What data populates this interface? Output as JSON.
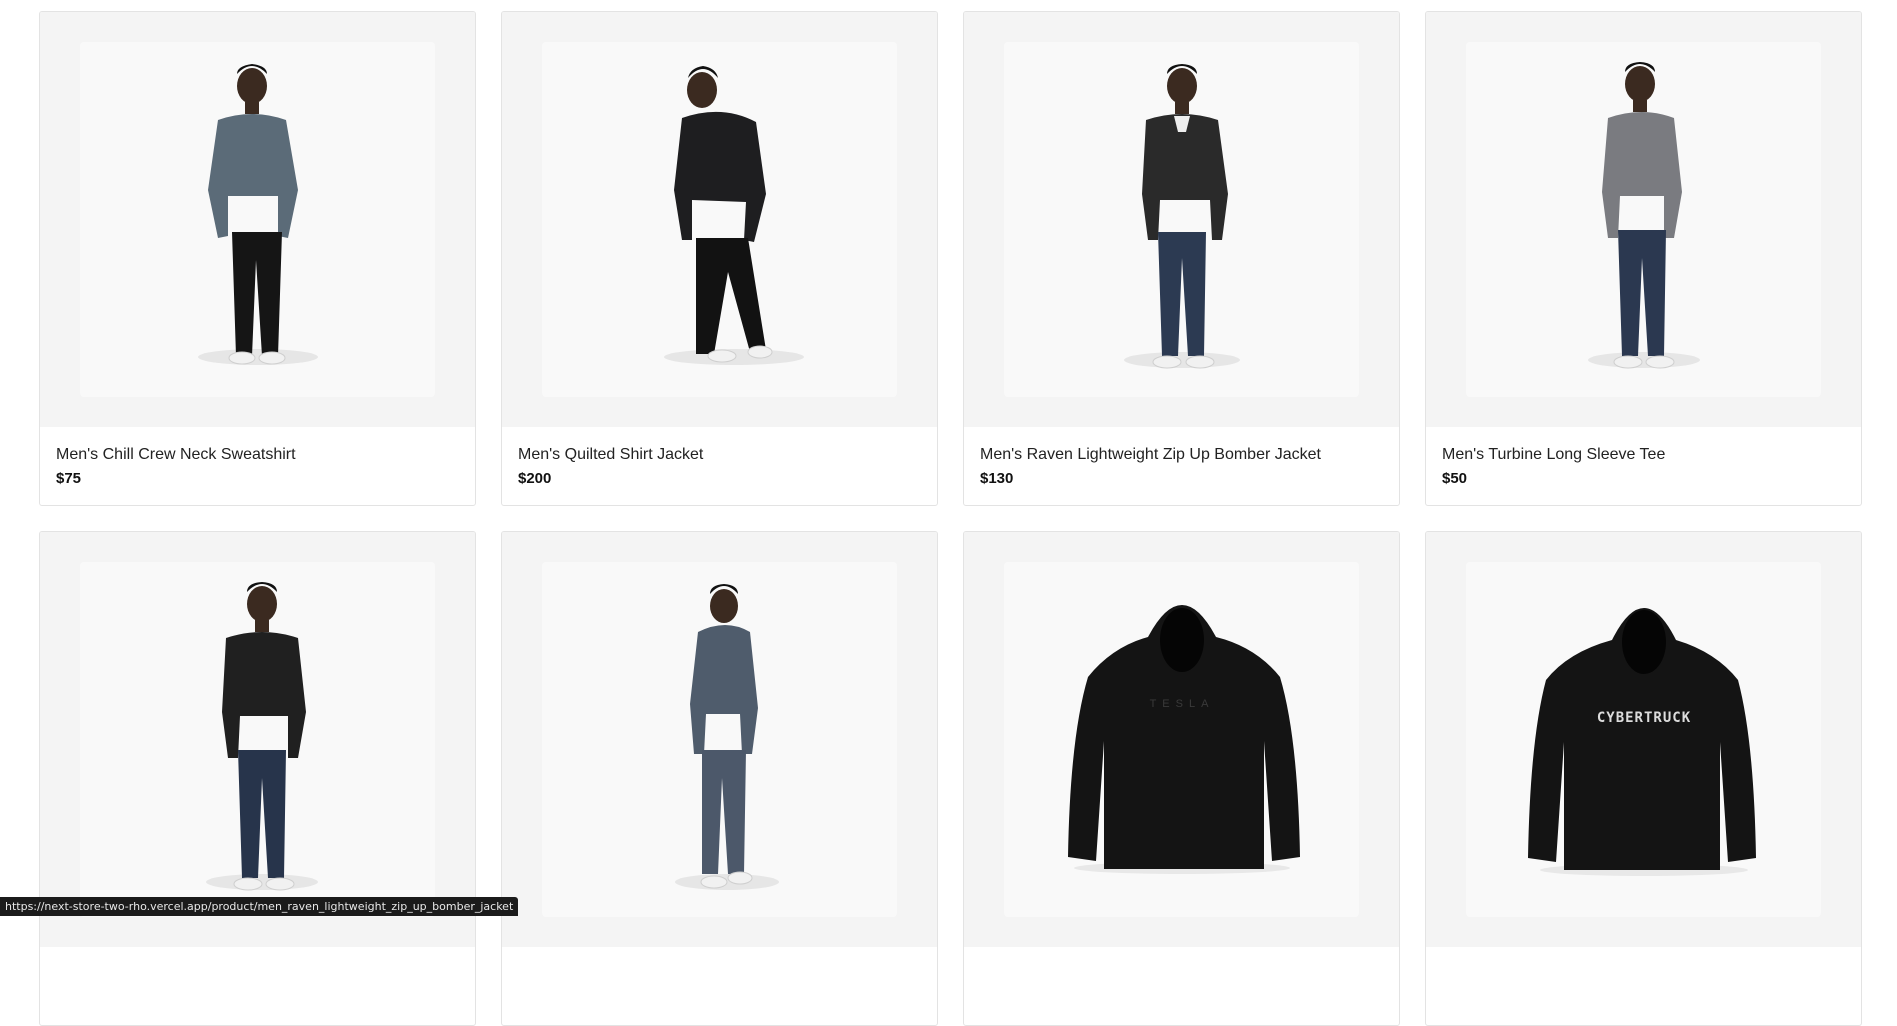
{
  "products": [
    {
      "name": "Men's Chill Crew Neck Sweatshirt",
      "price": "$75",
      "image": "man-gray-sweatshirt",
      "top_color": "#5b6b78",
      "bottom_color": "#151515"
    },
    {
      "name": "Men's Quilted Shirt Jacket",
      "price": "$200",
      "image": "man-black-quilted-jacket",
      "top_color": "#1e1e20",
      "bottom_color": "#121212"
    },
    {
      "name": "Men's Raven Lightweight Zip Up Bomber Jacket",
      "price": "$130",
      "image": "man-black-bomber-jacket",
      "top_color": "#2a2a2a",
      "bottom_color": "#2c3a52"
    },
    {
      "name": "Men's Turbine Long Sleeve Tee",
      "price": "$50",
      "image": "man-gray-long-sleeve-tee",
      "top_color": "#7a7b80",
      "bottom_color": "#2b3850"
    },
    {
      "name": "",
      "price": "",
      "image": "man-black-hoodie-jeans",
      "top_color": "#202020",
      "bottom_color": "#27344b"
    },
    {
      "name": "",
      "price": "",
      "image": "man-gray-tracksuit",
      "top_color": "#4f5c6c",
      "bottom_color": "#4c586a"
    },
    {
      "name": "",
      "price": "",
      "image": "black-tesla-hoodie",
      "top_color": "#141414",
      "print_text": "TESLA"
    },
    {
      "name": "",
      "price": "",
      "image": "black-cybertruck-hoodie",
      "top_color": "#141414",
      "print_text": "CYBERTRUCK"
    }
  ],
  "status_url": "https://next-store-two-rho.vercel.app/product/men_raven_lightweight_zip_up_bomber_jacket"
}
